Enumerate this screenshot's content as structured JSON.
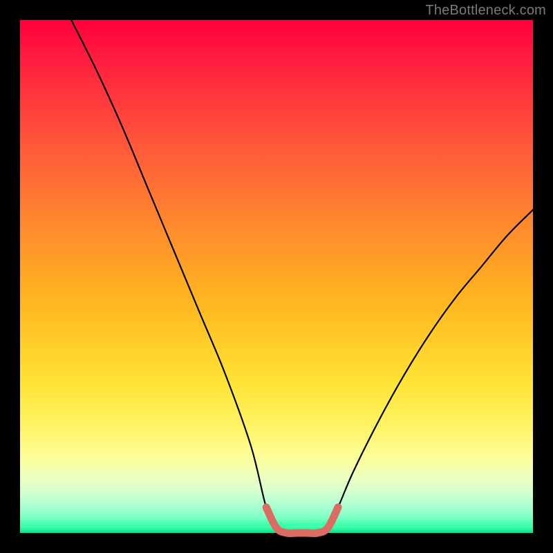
{
  "watermark": "TheBottleneck.com",
  "colors": {
    "frame": "#000000",
    "curve": "#000000",
    "highlight": "#d96d64",
    "gradient_top": "#ff003d",
    "gradient_bottom": "#00e58a"
  },
  "chart_data": {
    "type": "line",
    "title": "",
    "xlabel": "",
    "ylabel": "",
    "xlim": [
      0,
      100
    ],
    "ylim": [
      0,
      100
    ],
    "grid": false,
    "legend": false,
    "note": "V-shaped bottleneck curve; y is percent bottleneck, minimum near center. No axis ticks or labels are rendered.",
    "series": [
      {
        "name": "bottleneck-curve",
        "x": [
          10,
          15,
          20,
          25,
          30,
          35,
          40,
          45,
          48,
          50,
          52,
          54,
          56,
          58,
          60,
          62,
          65,
          70,
          75,
          80,
          85,
          90,
          95,
          100
        ],
        "y": [
          100,
          90,
          79,
          67,
          55,
          43,
          31,
          17,
          5,
          1,
          0,
          0,
          0,
          0,
          1,
          5,
          12,
          22,
          31,
          39,
          46,
          52,
          58,
          63
        ]
      }
    ],
    "highlight_segment": {
      "name": "flat-minimum",
      "x": [
        48,
        50,
        52,
        54,
        56,
        58,
        60,
        62
      ],
      "y": [
        5,
        1,
        0,
        0,
        0,
        0,
        1,
        5
      ]
    }
  }
}
